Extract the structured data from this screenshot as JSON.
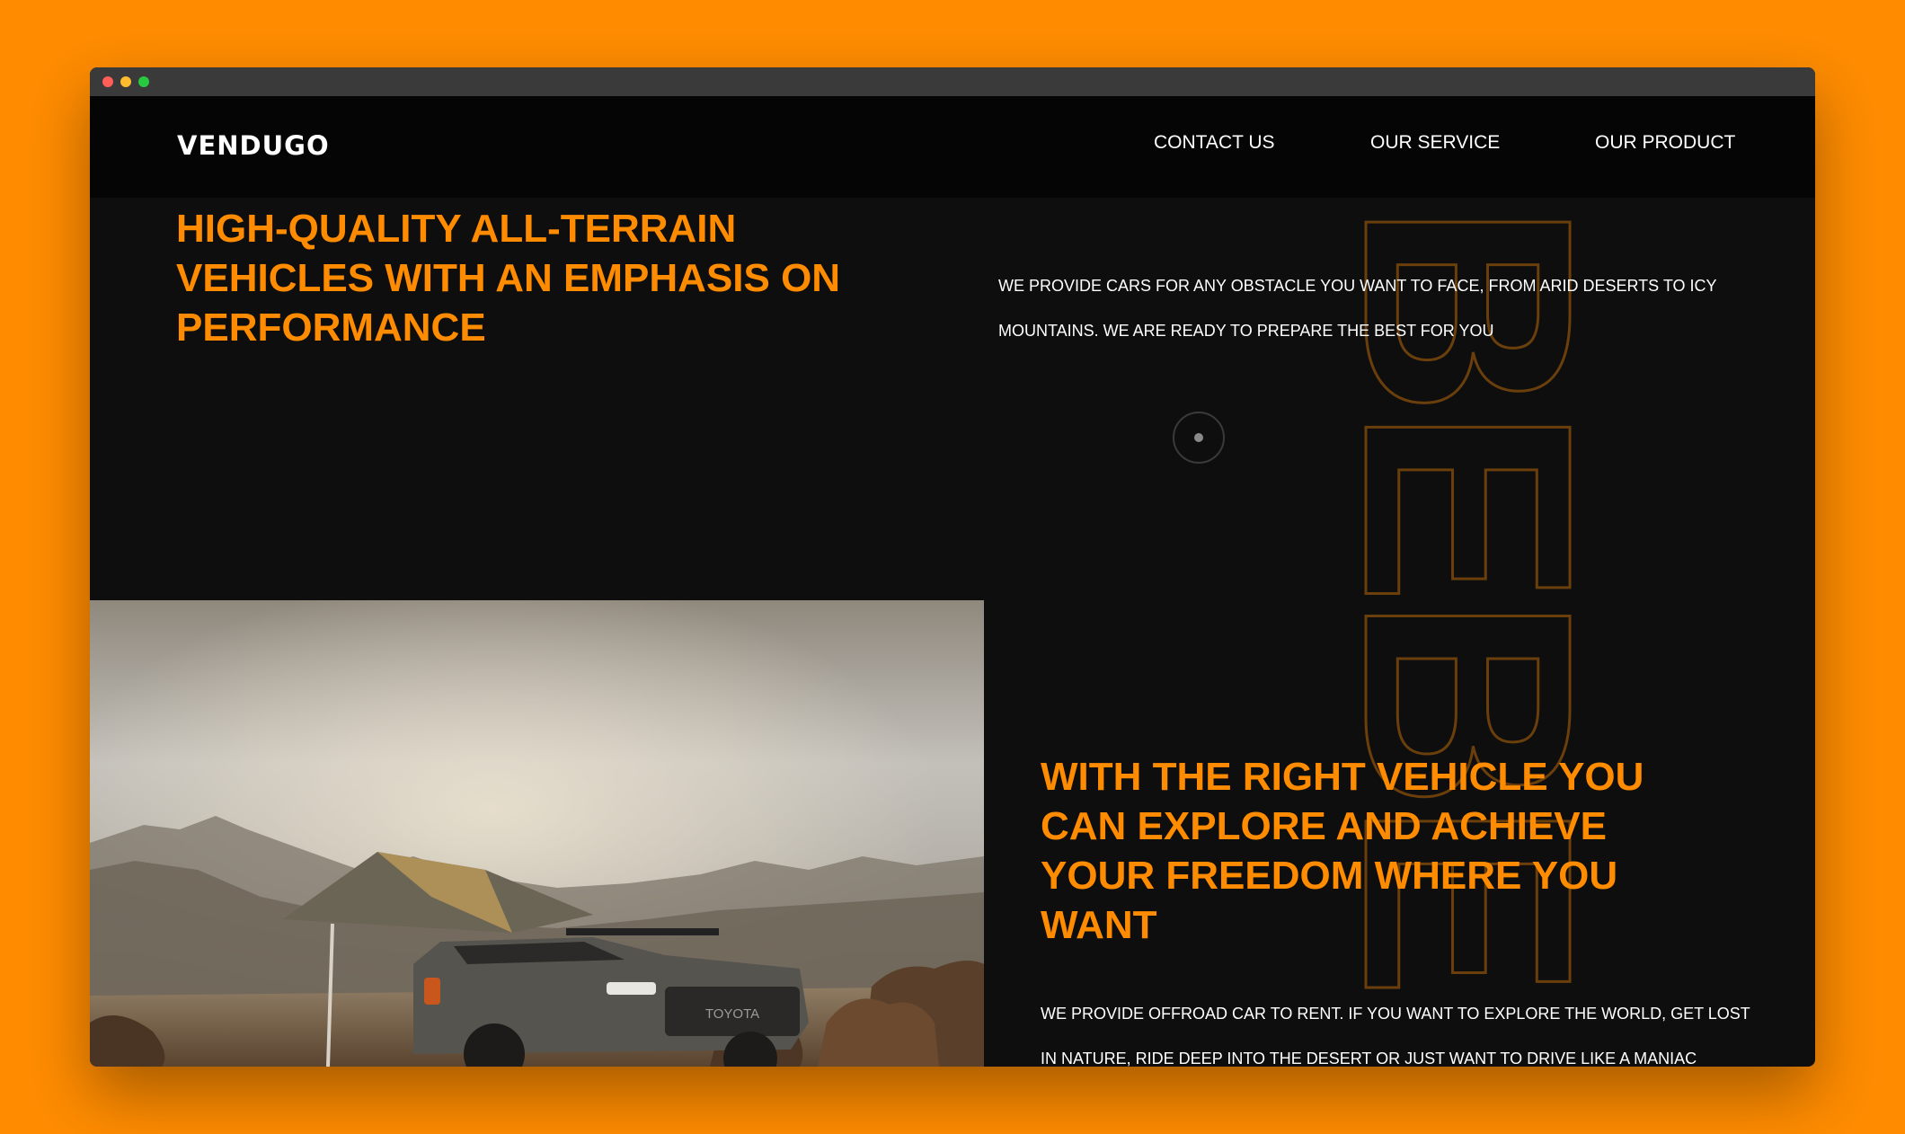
{
  "nav": {
    "logo": "VENDUGO",
    "links": [
      "CONTACT US",
      "OUR SERVICE",
      "OUR PRODUCT"
    ]
  },
  "hero": {
    "title": "HIGH-QUALITY ALL-TERRAIN VEHICLES WITH AN EMPHASIS ON PERFORMANCE",
    "text": "WE PROVIDE CARS FOR ANY OBSTACLE YOU WANT TO FACE, FROM ARID DESERTS TO ICY MOUNTAINS. WE ARE READY TO PREPARE THE BEST FOR YOU"
  },
  "background_word": "BEBE",
  "photo": {
    "vehicle_badge": "TOYOTA"
  },
  "section": {
    "title": "WITH THE RIGHT VEHICLE YOU CAN EXPLORE AND ACHIEVE YOUR FREEDOM WHERE YOU WANT",
    "text": "WE PROVIDE OFFROAD CAR TO RENT. IF YOU WANT TO EXPLORE THE WORLD, GET LOST IN NATURE, RIDE DEEP INTO THE DESERT OR JUST WANT TO DRIVE LIKE A MANIAC"
  },
  "colors": {
    "page_background": "#FF8C00",
    "accent": "#FF8C00",
    "window_background": "#0e0e0e",
    "navbar_background": "#050505",
    "text": "#ffffff"
  },
  "icons": [
    "close-dot-icon",
    "minimize-dot-icon",
    "maximize-dot-icon",
    "scroll-indicator-icon"
  ]
}
